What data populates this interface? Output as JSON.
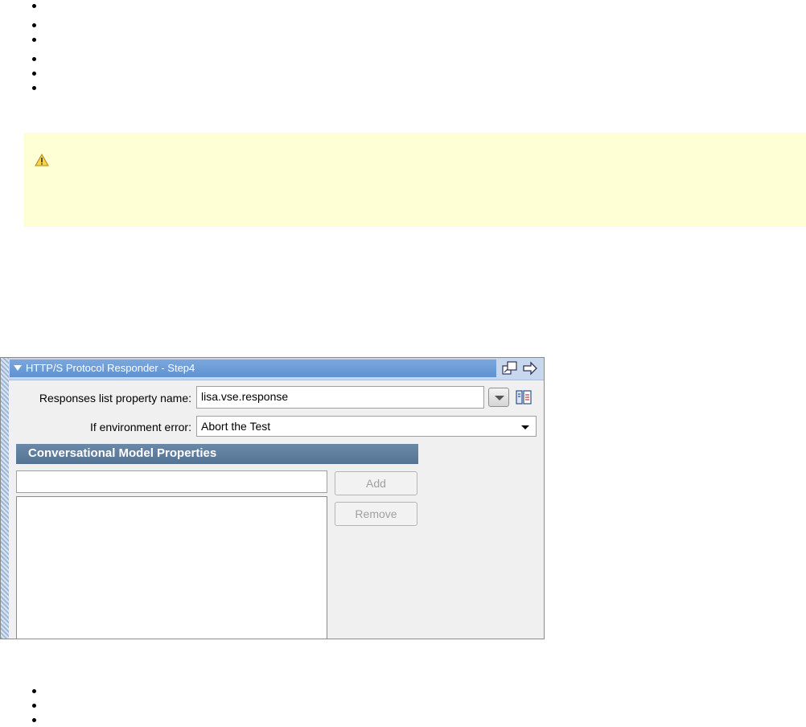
{
  "panel": {
    "title": "HTTP/S Protocol Responder - Step4",
    "responses_label": "Responses list property name:",
    "responses_value": "lisa.vse.response",
    "env_error_label": "If environment error:",
    "env_error_value": "Abort the Test",
    "section_title": "Conversational Model Properties",
    "property_input_value": "",
    "add_label": "Add",
    "remove_label": "Remove"
  },
  "icons": {
    "warning": "warning-icon",
    "float": "float-window-icon",
    "arrow": "arrow-right-icon",
    "dropdown": "chevron-down-icon",
    "properties": "properties-icon"
  },
  "colors": {
    "warning_bg": "#ffffd6",
    "title_bar": "#6b9bd7",
    "section_header": "#5f7e9f"
  }
}
